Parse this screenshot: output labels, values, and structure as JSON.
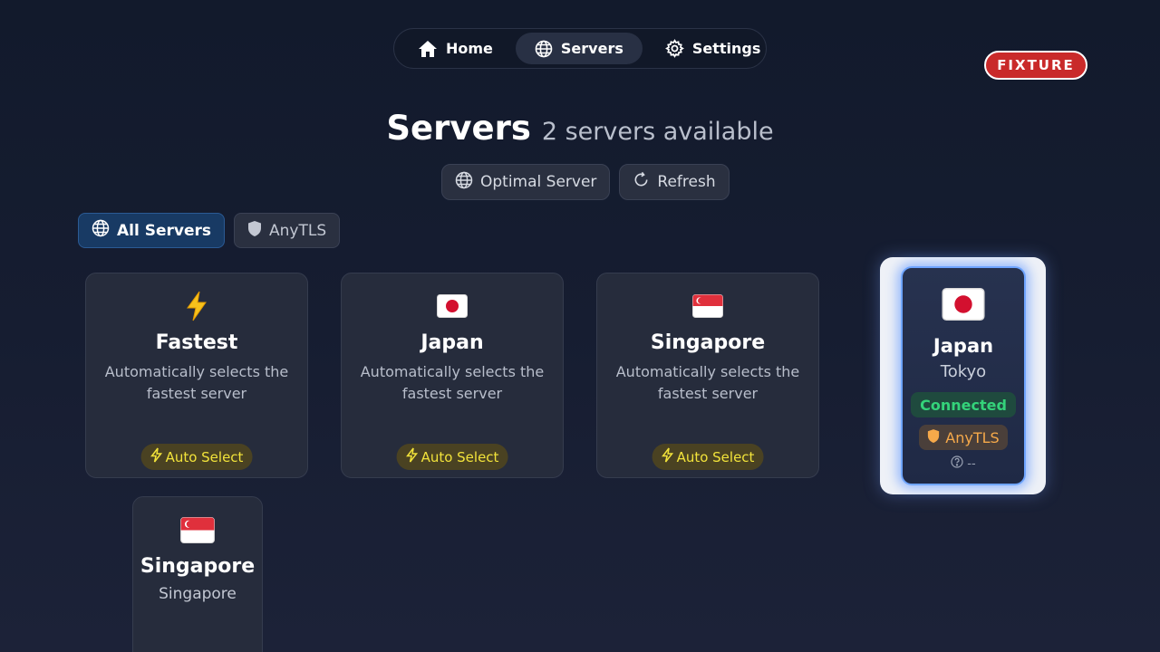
{
  "nav": {
    "items": [
      {
        "label": "Home",
        "icon": "home-icon"
      },
      {
        "label": "Servers",
        "icon": "globe-icon",
        "active": true
      },
      {
        "label": "Settings",
        "icon": "gear-icon"
      }
    ]
  },
  "badge": {
    "label": "FIXTURE",
    "color": "#c92a2a"
  },
  "header": {
    "title": "Servers",
    "subtitle": "2 servers available"
  },
  "actions": {
    "optimal_label": "Optimal Server",
    "refresh_label": "Refresh"
  },
  "filters": {
    "all_label": "All Servers",
    "anytls_label": "AnyTLS"
  },
  "cards": [
    {
      "icon": "lightning-icon",
      "name": "Fastest",
      "description": "Automatically selects the fastest server",
      "chip": "Auto Select"
    },
    {
      "icon": "japan-flag-icon",
      "name": "Japan",
      "description": "Automatically selects the fastest server",
      "chip": "Auto Select"
    },
    {
      "icon": "singapore-flag-icon",
      "name": "Singapore",
      "description": "Automatically selects the fastest server",
      "chip": "Auto Select"
    }
  ],
  "server_cards": [
    {
      "icon": "singapore-flag-icon",
      "name": "Singapore",
      "location": "Singapore"
    }
  ],
  "focused_server": {
    "icon": "japan-flag-icon",
    "name": "Japan",
    "location": "Tokyo",
    "status": "Connected",
    "protocol": "AnyTLS",
    "latency": "--"
  },
  "colors": {
    "accent_blue": "#6fa5ff",
    "connected_green": "#34d37a",
    "auto_select_yellow": "#f2e33a",
    "protocol_orange": "#f6a94a"
  }
}
